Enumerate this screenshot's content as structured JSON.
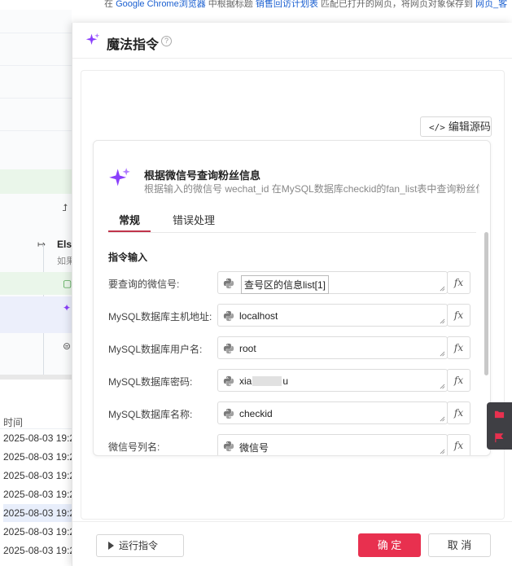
{
  "background": {
    "top_text_1": "在 ",
    "top_link_1": "Google Chrome浏览器",
    "top_text_2": " 中根据标题 ",
    "top_link_2": "销售回访计划表",
    "top_text_3": " 匹配已打开的网页，将网页对象保存到 ",
    "top_link_3": "网页_客",
    "else_label": "Els",
    "else_hint": "如果",
    "time_header": "时间",
    "time_rows": [
      "2025-08-03 19:2",
      "2025-08-03 19:2",
      "2025-08-03 19:2",
      "2025-08-03 19:2",
      "2025-08-03 19:2",
      "2025-08-03 19:2",
      "2025-08-03 19:2"
    ]
  },
  "dialog": {
    "title": "魔法指令",
    "help_icon": "?",
    "edit_source_label": "编辑源码",
    "card": {
      "title": "根据微信号查询粉丝信息",
      "description": "根据输入的微信号 wechat_id 在MySQL数据库checkid的fan_list表中查询粉丝信息"
    },
    "tabs": [
      {
        "label": "常规",
        "active": true
      },
      {
        "label": "错误处理",
        "active": false
      }
    ],
    "section_title": "指令输入",
    "fields": [
      {
        "label": "要查询的微信号:",
        "value": "查号区的信息list[1]"
      },
      {
        "label": "MySQL数据库主机地址:",
        "value": "localhost"
      },
      {
        "label": "MySQL数据库用户名:",
        "value": "root"
      },
      {
        "label": "MySQL数据库密码:",
        "value_prefix": "xia",
        "value_suffix": "u"
      },
      {
        "label": "MySQL数据库名称:",
        "value": "checkid"
      },
      {
        "label": "微信号列名:",
        "value": "微信号"
      }
    ],
    "fx_label": "fx",
    "footer": {
      "run_label": "运行指令",
      "ok_label": "确 定",
      "cancel_label": "取 消"
    }
  },
  "colors": {
    "primary": "#e8304f",
    "tab_accent": "#c0344b",
    "magic_star": "#8a3ffc",
    "link": "#1a5fd0",
    "side_tool_bg": "#3f3f44"
  },
  "icons": [
    "sparkle-icon",
    "help-icon",
    "code-icon",
    "python-icon",
    "fx-icon",
    "resize-icon",
    "play-icon",
    "folder-icon",
    "flag-icon"
  ]
}
